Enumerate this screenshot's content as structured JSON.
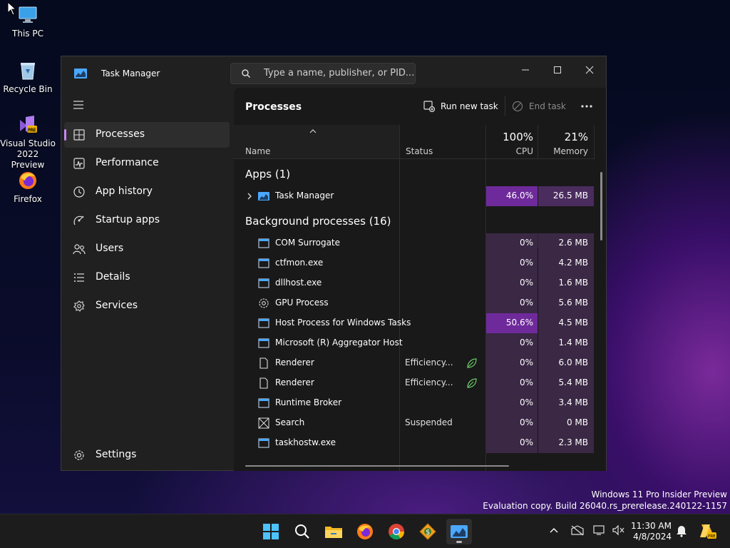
{
  "desktop": {
    "icons": [
      {
        "label": "This PC"
      },
      {
        "label": "Recycle Bin"
      },
      {
        "label": "Visual Studio 2022 Preview"
      },
      {
        "label": "Firefox"
      }
    ],
    "watermark_line1": "Windows 11 Pro Insider Preview",
    "watermark_line2": "Evaluation copy. Build 26040.rs_prerelease.240122-1157"
  },
  "window": {
    "title": "Task Manager",
    "search_placeholder": "Type a name, publisher, or PID..."
  },
  "sidebar": {
    "items": [
      {
        "label": "Processes",
        "icon": "processes-icon",
        "active": true
      },
      {
        "label": "Performance",
        "icon": "performance-icon"
      },
      {
        "label": "App history",
        "icon": "app-history-icon"
      },
      {
        "label": "Startup apps",
        "icon": "startup-apps-icon"
      },
      {
        "label": "Users",
        "icon": "users-icon"
      },
      {
        "label": "Details",
        "icon": "details-icon"
      },
      {
        "label": "Services",
        "icon": "services-icon"
      }
    ],
    "settings_label": "Settings"
  },
  "main": {
    "title": "Processes",
    "run_new_task": "Run new task",
    "end_task": "End task",
    "columns": {
      "name": "Name",
      "status": "Status",
      "cpu_total": "100%",
      "cpu": "CPU",
      "memory_total": "21%",
      "memory": "Memory"
    },
    "apps_group": "Apps (1)",
    "apps": [
      {
        "name": "Task Manager",
        "status": "",
        "cpu": "46.0%",
        "memory": "26.5 MB"
      }
    ],
    "bg_group": "Background processes (16)",
    "processes": [
      {
        "name": "COM Surrogate",
        "status": "",
        "cpu": "0%",
        "memory": "2.6 MB"
      },
      {
        "name": "ctfmon.exe",
        "status": "",
        "cpu": "0%",
        "memory": "4.2 MB"
      },
      {
        "name": "dllhost.exe",
        "status": "",
        "cpu": "0%",
        "memory": "1.6 MB"
      },
      {
        "name": "GPU Process",
        "status": "",
        "cpu": "0%",
        "memory": "5.6 MB"
      },
      {
        "name": "Host Process for Windows Tasks",
        "status": "",
        "cpu": "50.6%",
        "memory": "4.5 MB"
      },
      {
        "name": "Microsoft (R) Aggregator Host",
        "status": "",
        "cpu": "0%",
        "memory": "1.4 MB"
      },
      {
        "name": "Renderer",
        "status": "Efficiency...",
        "cpu": "0%",
        "memory": "6.0 MB"
      },
      {
        "name": "Renderer",
        "status": "Efficiency...",
        "cpu": "0%",
        "memory": "5.4 MB"
      },
      {
        "name": "Runtime Broker",
        "status": "",
        "cpu": "0%",
        "memory": "3.4 MB"
      },
      {
        "name": "Search",
        "status": "Suspended",
        "cpu": "0%",
        "memory": "0 MB"
      },
      {
        "name": "taskhostw.exe",
        "status": "",
        "cpu": "0%",
        "memory": "2.3 MB"
      }
    ]
  },
  "taskbar": {
    "time": "11:30 AM",
    "date": "4/8/2024"
  },
  "colors": {
    "accent": "#c587f2",
    "heat_low": "#3a2844",
    "heat_high": "#6e2a9a"
  }
}
